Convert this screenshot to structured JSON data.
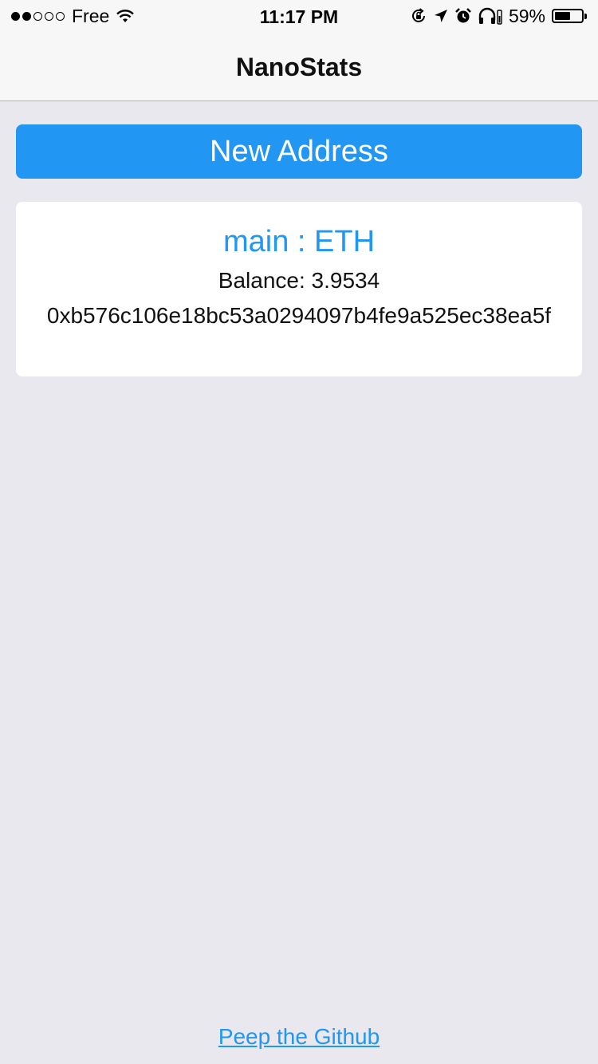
{
  "status_bar": {
    "carrier": "Free",
    "signal_bars_filled": 2,
    "signal_bars_total": 5,
    "time": "11:17 PM",
    "battery_percent": "59%",
    "battery_level": 0.59,
    "icons": [
      "wifi-icon",
      "orientation-lock-icon",
      "location-icon",
      "alarm-icon",
      "headphones-icon",
      "battery-icon"
    ]
  },
  "nav": {
    "title": "NanoStats"
  },
  "actions": {
    "new_address_label": "New Address"
  },
  "addresses": [
    {
      "title": "main : ETH",
      "balance": "Balance: 3.9534",
      "address": "0xb576c106e18bc53a0294097b4fe9a525ec38ea5f"
    }
  ],
  "footer": {
    "github_link": "Peep the Github"
  },
  "colors": {
    "accent": "#2196f3",
    "background": "#e9e8ee",
    "bar": "#f7f7f7",
    "card": "#ffffff"
  }
}
